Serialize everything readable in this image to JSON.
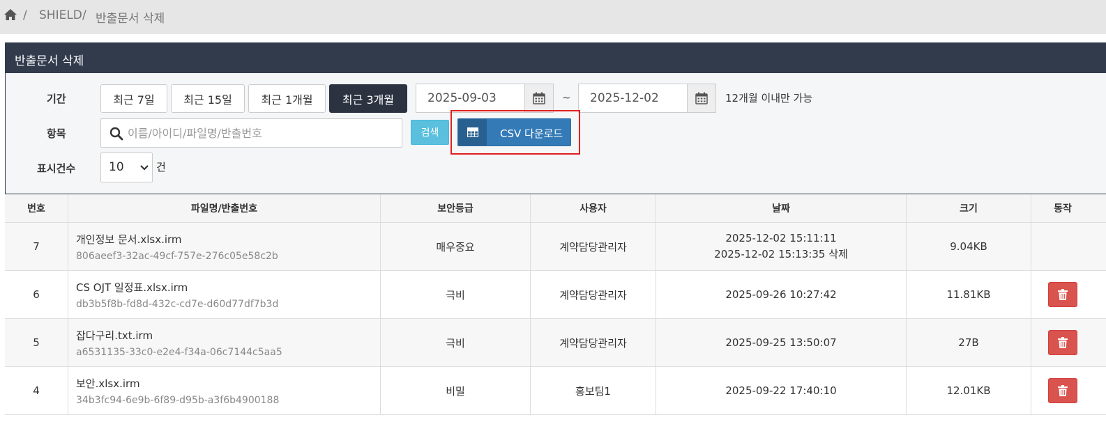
{
  "breadcrumb": {
    "home_icon": "home-icon",
    "items": [
      "SHIELD",
      "반출문서 삭제"
    ],
    "separator": "/"
  },
  "panel": {
    "title": "반출문서 삭제",
    "period_label": "기간",
    "period_buttons": [
      "최근 7일",
      "최근 15일",
      "최근 1개월",
      "최근 3개월"
    ],
    "active_period": "최근 3개월",
    "date_from": "2025-09-03",
    "date_to": "2025-12-02",
    "date_separator": "~",
    "range_hint": "12개월 이내만 가능",
    "item_label": "항목",
    "search_placeholder": "이름/아이디/파일명/반출번호",
    "search_button": "검색",
    "csv_button": "CSV 다운로드",
    "page_size_label": "표시건수",
    "page_size_value": "10",
    "page_size_unit": "건"
  },
  "colors": {
    "panel_header": "#313b4c",
    "active_button": "#2c3340",
    "search_button": "#5bc0de",
    "csv_button": "#337ab7",
    "delete_button": "#d9534f",
    "highlight": "#e02020"
  },
  "table": {
    "columns": [
      "번호",
      "파일명/반출번호",
      "보안등급",
      "사용자",
      "날짜",
      "크기",
      "동작"
    ],
    "rows": [
      {
        "no": "7",
        "filename": "개인정보 문서.xlsx.irm",
        "export_id": "806aeef3-32ac-49cf-757e-276c05e58c2b",
        "grade": "매우중요",
        "user": "계약담당관리자",
        "date": "2025-12-02 15:11:11",
        "date2": "2025-12-02 15:13:35 삭제",
        "size": "9.04KB"
      },
      {
        "no": "6",
        "filename": "CS OJT 일정표.xlsx.irm",
        "export_id": "db3b5f8b-fd8d-432c-cd7e-d60d77df7b3d",
        "grade": "극비",
        "user": "계약담당관리자",
        "date": "2025-09-26 10:27:42",
        "size": "11.81KB"
      },
      {
        "no": "5",
        "filename": "잡다구리.txt.irm",
        "export_id": "a6531135-33c0-e2e4-f34a-06c7144c5aa5",
        "grade": "극비",
        "user": "계약담당관리자",
        "date": "2025-09-25 13:50:07",
        "size": "27B"
      },
      {
        "no": "4",
        "filename": "보안.xlsx.irm",
        "export_id": "34b3fc94-6e9b-6f89-d95b-a3f6b4900188",
        "grade": "비밀",
        "user": "홍보팀1",
        "date": "2025-09-22 17:40:10",
        "size": "12.01KB"
      }
    ]
  }
}
